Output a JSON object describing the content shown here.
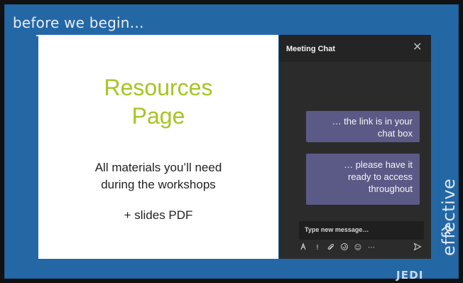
{
  "slide": {
    "title": "before we begin…"
  },
  "card": {
    "heading_line1": "Resources",
    "heading_line2": "Page",
    "body_line1": "All materials you’ll need",
    "body_line2": "during the workshops",
    "extra": "+ slides PDF",
    "heading_color": "#a5c522"
  },
  "chat": {
    "title": "Meeting Chat",
    "close_icon": "close-icon",
    "messages": [
      {
        "line1": "… the link is in your",
        "line2": "chat box"
      },
      {
        "line1": "… please have it",
        "line2": "ready to access",
        "line3": "throughout"
      }
    ],
    "compose_placeholder": "Type new message…",
    "toolbar": {
      "format_icon": "format-icon",
      "important_icon": "exclamation-icon",
      "attach_icon": "paperclip-icon",
      "loop_icon": "loop-icon",
      "emoji_icon": "emoji-icon",
      "more_icon": "more-icon",
      "send_icon": "send-icon"
    }
  },
  "branding": {
    "side_text": "effective",
    "bottom_mark": "JEDI"
  }
}
